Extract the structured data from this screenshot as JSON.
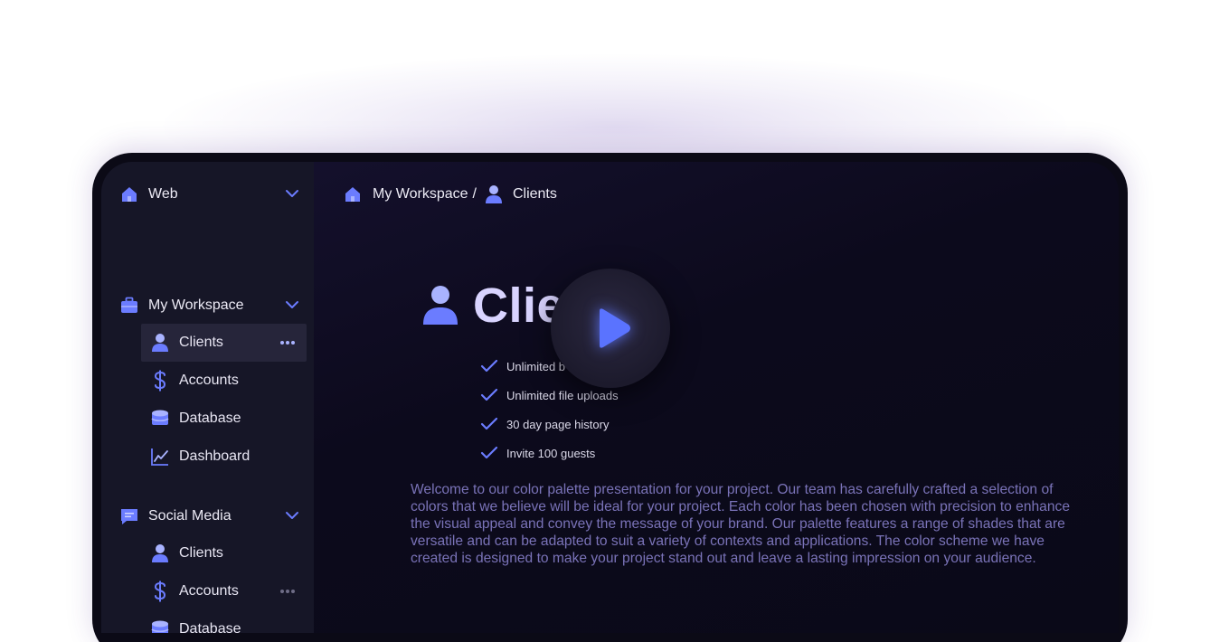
{
  "sidebar": {
    "groups": [
      {
        "label": "Web",
        "icon": "home-icon",
        "items": []
      },
      {
        "label": "My Workspace",
        "icon": "briefcase-icon",
        "items": [
          {
            "label": "Clients",
            "icon": "user-icon",
            "active": true
          },
          {
            "label": "Accounts",
            "icon": "dollar-icon"
          },
          {
            "label": "Database",
            "icon": "database-icon"
          },
          {
            "label": "Dashboard",
            "icon": "chart-line-icon"
          }
        ]
      },
      {
        "label": "Social Media",
        "icon": "chat-icon",
        "items": [
          {
            "label": "Clients",
            "icon": "user-icon"
          },
          {
            "label": "Accounts",
            "icon": "dollar-icon"
          },
          {
            "label": "Database",
            "icon": "database-icon"
          }
        ]
      }
    ]
  },
  "breadcrumb": {
    "workspace": "My Workspace",
    "separator": "/",
    "page": "Clients"
  },
  "hero": {
    "title": "Clie",
    "features": [
      "Unlimited b",
      "Unlimited file uploads",
      "30 day page history",
      "Invite 100 guests"
    ],
    "description": "Welcome to our color palette presentation for your project. Our team has carefully crafted a selection of colors that we believe will be ideal for your project. Each color has been chosen with precision to enhance the visual appeal and convey the message of your brand. Our palette features a range of shades that are versatile and can be adapted to suit a variety of contexts and applications. The color scheme we have created is designed to make your project stand out and leave a lasting impression on your audience."
  },
  "colors": {
    "accent": "#6b7cff",
    "sidebar": "#161627",
    "main": "#0b0919",
    "text_muted": "#7a73b8",
    "title": "#d9d4ff"
  }
}
